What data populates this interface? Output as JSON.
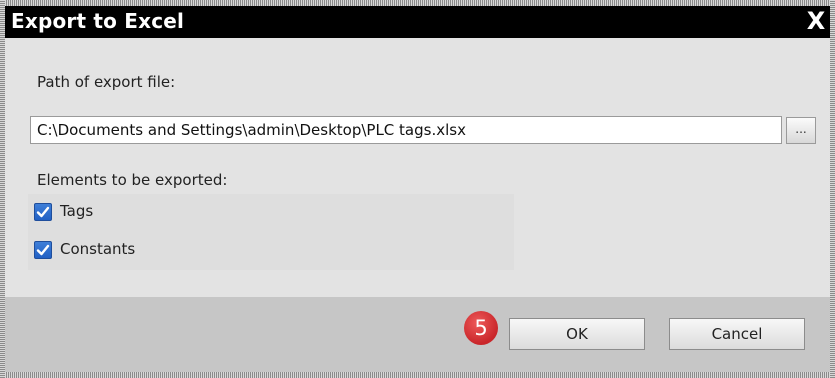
{
  "dialog": {
    "title": "Export to Excel",
    "close_label": "X"
  },
  "path": {
    "label": "Path of export file:",
    "value": "C:\\Documents and Settings\\admin\\Desktop\\PLC tags.xlsx",
    "browse_label": "..."
  },
  "elements": {
    "label": "Elements to be exported:",
    "items": [
      {
        "label": "Tags",
        "checked": true
      },
      {
        "label": "Constants",
        "checked": true
      }
    ]
  },
  "footer": {
    "step_number": "5",
    "ok_label": "OK",
    "cancel_label": "Cancel"
  },
  "colors": {
    "titlebar": "#000000",
    "checkbox": "#2d6bd0",
    "step_badge": "#d9363a"
  }
}
